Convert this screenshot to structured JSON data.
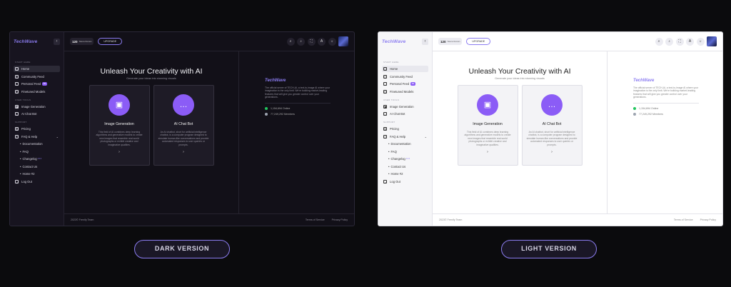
{
  "variants": [
    {
      "id": "dark",
      "button_label": "DARK VERSION"
    },
    {
      "id": "light",
      "button_label": "LIGHT VERSION"
    }
  ],
  "app": {
    "logo": "TechWave",
    "sidebar": {
      "sections": [
        {
          "title": "START HERE",
          "items": [
            {
              "label": "Home",
              "icon": "home-icon",
              "active": true
            },
            {
              "label": "Community Feed",
              "icon": "feed-icon"
            },
            {
              "label": "Personal Feed",
              "icon": "user-icon",
              "badge": "99"
            },
            {
              "label": "Finetuned Models",
              "icon": "model-icon"
            }
          ]
        },
        {
          "title": "USER TOOLS",
          "items": [
            {
              "label": "Image Generation",
              "icon": "image-icon"
            },
            {
              "label": "AI Chat Bot",
              "icon": "chat-icon"
            }
          ]
        },
        {
          "title": "SUPPORT",
          "items": [
            {
              "label": "Pricing",
              "icon": "dollar-icon"
            },
            {
              "label": "FAQ & Help",
              "icon": "help-icon",
              "expandable": true
            },
            {
              "label": "Documentation",
              "sub": true
            },
            {
              "label": "FAQ",
              "sub": true
            },
            {
              "label": "Changelog",
              "sub": true,
              "badge_sup": "4.0.0"
            },
            {
              "label": "Contact Us",
              "sub": true
            },
            {
              "label": "Home #2",
              "sub": true
            },
            {
              "label": "Log Out",
              "icon": "logout-icon"
            }
          ]
        }
      ]
    },
    "topbar": {
      "tokens_count": "120",
      "tokens_label": "Tokens Remain",
      "upgrade_label": "UPGRADE",
      "icons": [
        "search-icon",
        "bell-icon",
        "fullscreen-icon",
        "translate-icon",
        "theme-toggle-icon",
        "avatar"
      ]
    },
    "hero": {
      "title": "Unleash Your Creativity with AI",
      "subtitle": "Generate your ideas into stunning visuals"
    },
    "cards": [
      {
        "title": "Image Generation",
        "icon": "image-icon",
        "description": "This field of AI combines deep learning algorithms and generative models to create new images that resemble real-world photographs or exhibit creative and imaginative qualities."
      },
      {
        "title": "AI Chat Bot",
        "icon": "chat-bubble-icon",
        "description": "An AI chatbot, short for artificial intelligence chatbot, is a computer program designed to simulate human-like conversations and provide automated responses to user queries or prompts."
      }
    ],
    "right_panel": {
      "logo": "TechWave",
      "description": "The official server of TECH-AI, a text-to-image AI where your imagination is the only limit. We're building market-leading features that will give you greater control over your generations.",
      "online": "1,154,694 Online",
      "members": "77,249,292 Members",
      "online_color": "#22c55e",
      "members_color": "#9ca3af"
    },
    "footer": {
      "copyright": "2023© Frenify Team",
      "links": [
        "Terms of Service",
        "Privacy Policy"
      ]
    }
  }
}
